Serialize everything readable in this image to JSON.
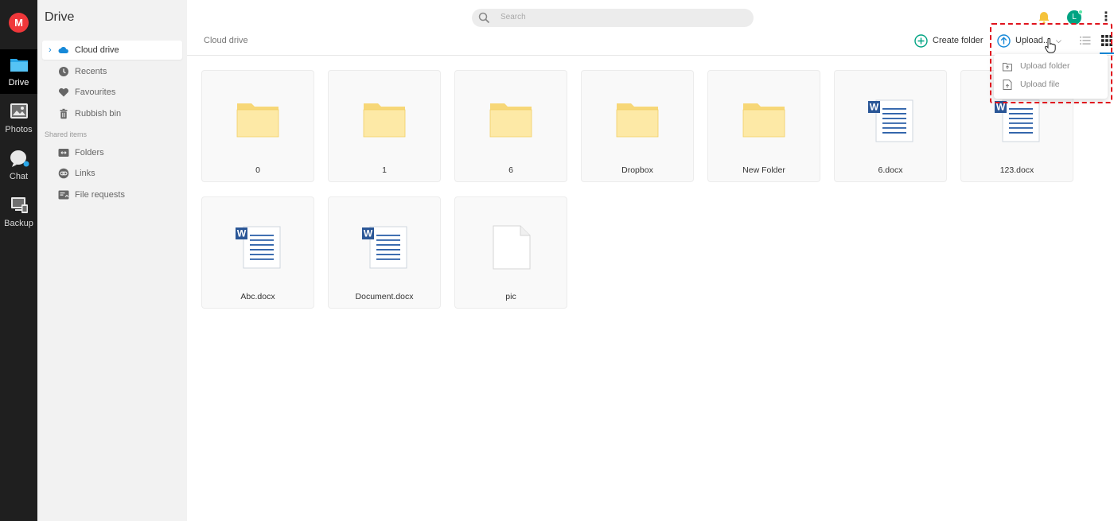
{
  "app": {
    "logo_letter": "M",
    "brand_color": "#f0373a",
    "accent_color": "#1789d8"
  },
  "rail": [
    {
      "label": "Drive",
      "icon": "drive-folder-icon",
      "active": true
    },
    {
      "label": "Photos",
      "icon": "photos-icon",
      "active": false
    },
    {
      "label": "Chat",
      "icon": "chat-icon",
      "active": false
    },
    {
      "label": "Backup",
      "icon": "backup-icon",
      "active": false
    }
  ],
  "sidebar": {
    "title": "Drive",
    "items": [
      {
        "label": "Cloud drive",
        "icon": "cloud-icon",
        "active": true
      },
      {
        "label": "Recents",
        "icon": "clock-icon"
      },
      {
        "label": "Favourites",
        "icon": "heart-icon"
      },
      {
        "label": "Rubbish bin",
        "icon": "trash-icon"
      }
    ],
    "section_label": "Shared items",
    "shared_items": [
      {
        "label": "Folders",
        "icon": "shared-folder-icon"
      },
      {
        "label": "Links",
        "icon": "link-icon"
      },
      {
        "label": "File requests",
        "icon": "file-request-icon"
      }
    ]
  },
  "header": {
    "search_placeholder": "Search",
    "avatar_letter": "L",
    "breadcrumb": "Cloud drive",
    "create_folder_label": "Create folder",
    "upload_label": "Upload..."
  },
  "upload_menu": {
    "items": [
      {
        "label": "Upload folder",
        "icon": "upload-folder-icon"
      },
      {
        "label": "Upload file",
        "icon": "upload-file-icon"
      }
    ]
  },
  "files": [
    {
      "name": "0",
      "kind": "folder"
    },
    {
      "name": "1",
      "kind": "folder"
    },
    {
      "name": "6",
      "kind": "folder"
    },
    {
      "name": "Dropbox",
      "kind": "folder"
    },
    {
      "name": "New Folder",
      "kind": "folder"
    },
    {
      "name": "6.docx",
      "kind": "word"
    },
    {
      "name": "123.docx",
      "kind": "word"
    },
    {
      "name": "Abc.docx",
      "kind": "word"
    },
    {
      "name": "Document.docx",
      "kind": "word"
    },
    {
      "name": "pic",
      "kind": "generic"
    }
  ]
}
